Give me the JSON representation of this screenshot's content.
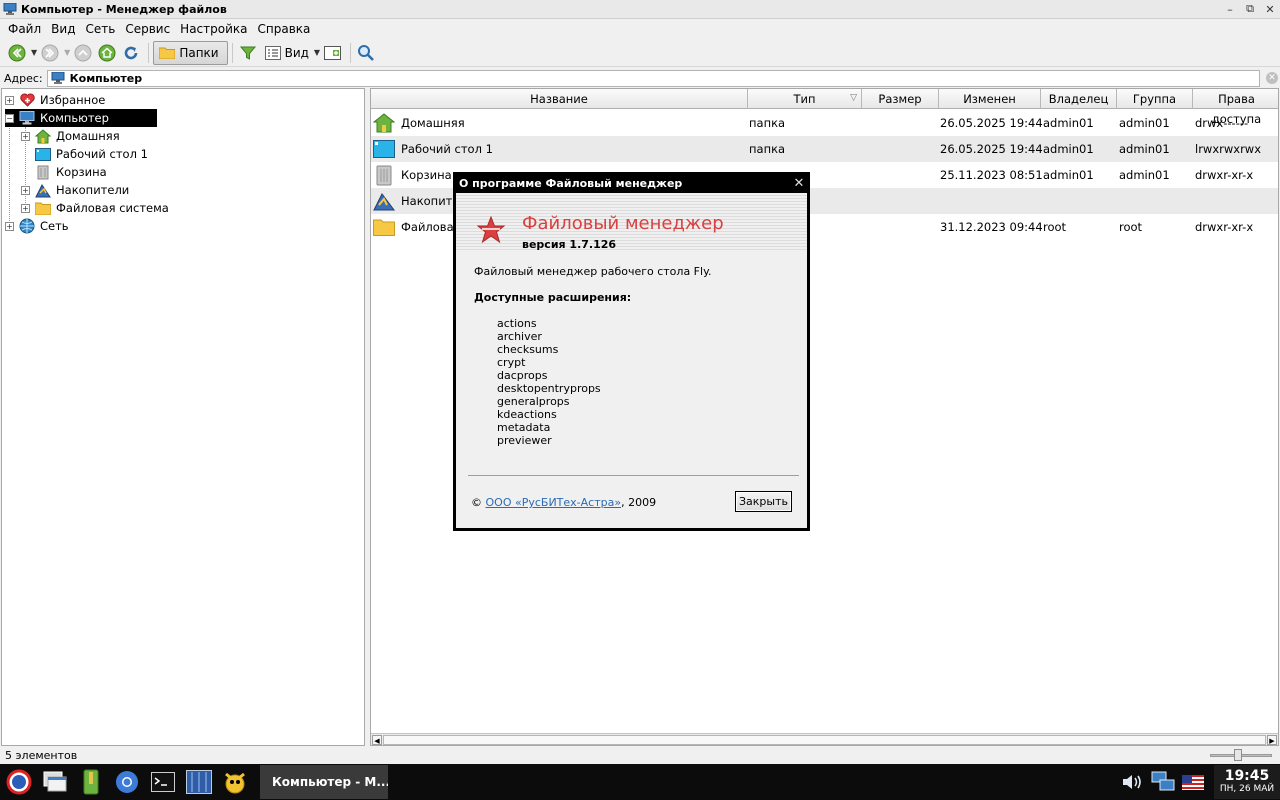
{
  "window": {
    "title": "Компьютер - Менеджер файлов",
    "controls": [
      "–",
      "⧉",
      "✕"
    ]
  },
  "menu": [
    "Файл",
    "Вид",
    "Сеть",
    "Сервис",
    "Настройка",
    "Справка"
  ],
  "toolbar": {
    "folders_label": "Папки",
    "view_label": "Вид",
    "icons": [
      "back-icon",
      "forward-icon",
      "up-icon",
      "home-icon",
      "refresh-icon",
      "folder-icon",
      "filter-icon",
      "view-icon",
      "new-tab-icon",
      "search-icon"
    ],
    "accent": "#5aa02c"
  },
  "address": {
    "label": "Адрес:",
    "value": "Компьютер"
  },
  "tree": [
    {
      "label": "Избранное",
      "icon": "favorites-heart-icon",
      "level": 0,
      "expander": "+"
    },
    {
      "label": "Компьютер",
      "icon": "computer-icon",
      "level": 0,
      "expander": "−",
      "selected": true
    },
    {
      "label": "Домашняя",
      "icon": "home-folder-icon",
      "level": 1,
      "expander": "+"
    },
    {
      "label": "Рабочий стол 1",
      "icon": "desktop-icon",
      "level": 1,
      "expander": ""
    },
    {
      "label": "Корзина",
      "icon": "trash-icon",
      "level": 1,
      "expander": ""
    },
    {
      "label": "Накопители",
      "icon": "drives-icon",
      "level": 1,
      "expander": "+"
    },
    {
      "label": "Файловая система",
      "icon": "folder-icon",
      "level": 1,
      "expander": "+"
    },
    {
      "label": "Сеть",
      "icon": "network-globe-icon",
      "level": 0,
      "expander": "+"
    }
  ],
  "filelist": {
    "columns": [
      "Название",
      "Тип",
      "Размер",
      "Изменен",
      "Владелец",
      "Группа",
      "Права доступа"
    ],
    "rows": [
      {
        "name": "Домашняя",
        "icon": "home-folder-icon",
        "type": "папка",
        "size": "",
        "modified": "26.05.2025 19:44",
        "owner": "admin01",
        "group": "admin01",
        "perms": "drwx------"
      },
      {
        "name": "Рабочий стол 1",
        "icon": "desktop-icon",
        "type": "папка",
        "size": "",
        "modified": "26.05.2025 19:44",
        "owner": "admin01",
        "group": "admin01",
        "perms": "lrwxrwxrwx"
      },
      {
        "name": "Корзина",
        "icon": "trash-icon",
        "type": "",
        "size": "",
        "modified": "25.11.2023 08:51",
        "owner": "admin01",
        "group": "admin01",
        "perms": "drwxr-xr-x"
      },
      {
        "name": "Накопители",
        "icon": "drives-icon",
        "type": "",
        "size": "",
        "modified": "",
        "owner": "",
        "group": "",
        "perms": ""
      },
      {
        "name": "Файловая система",
        "icon": "folder-icon",
        "type": "",
        "size": "",
        "modified": "31.12.2023 09:44",
        "owner": "root",
        "group": "root",
        "perms": "drwxr-xr-x"
      }
    ]
  },
  "status": {
    "text": "5 элементов",
    "zoom_fraction": 0.45
  },
  "dialog": {
    "title": "О программе Файловый менеджер",
    "app_name": "Файловый менеджер",
    "version": "версия 1.7.126",
    "description": "Файловый менеджер рабочего стола Fly.",
    "extensions_heading": "Доступные расширения:",
    "extensions": [
      "actions",
      "archiver",
      "checksums",
      "crypt",
      "dacprops",
      "desktopentryprops",
      "generalprops",
      "kdeactions",
      "metadata",
      "previewer"
    ],
    "copyright_sign": "©",
    "company_link": "ООО «РусБИТех-Астра»",
    "year": ", 2009",
    "close_label": "Закрыть",
    "brand_color": "#d9403f"
  },
  "taskbar": {
    "active_task": "Компьютер - М...",
    "clock_time": "19:45",
    "clock_date": "ПН, 26 МАЙ"
  }
}
